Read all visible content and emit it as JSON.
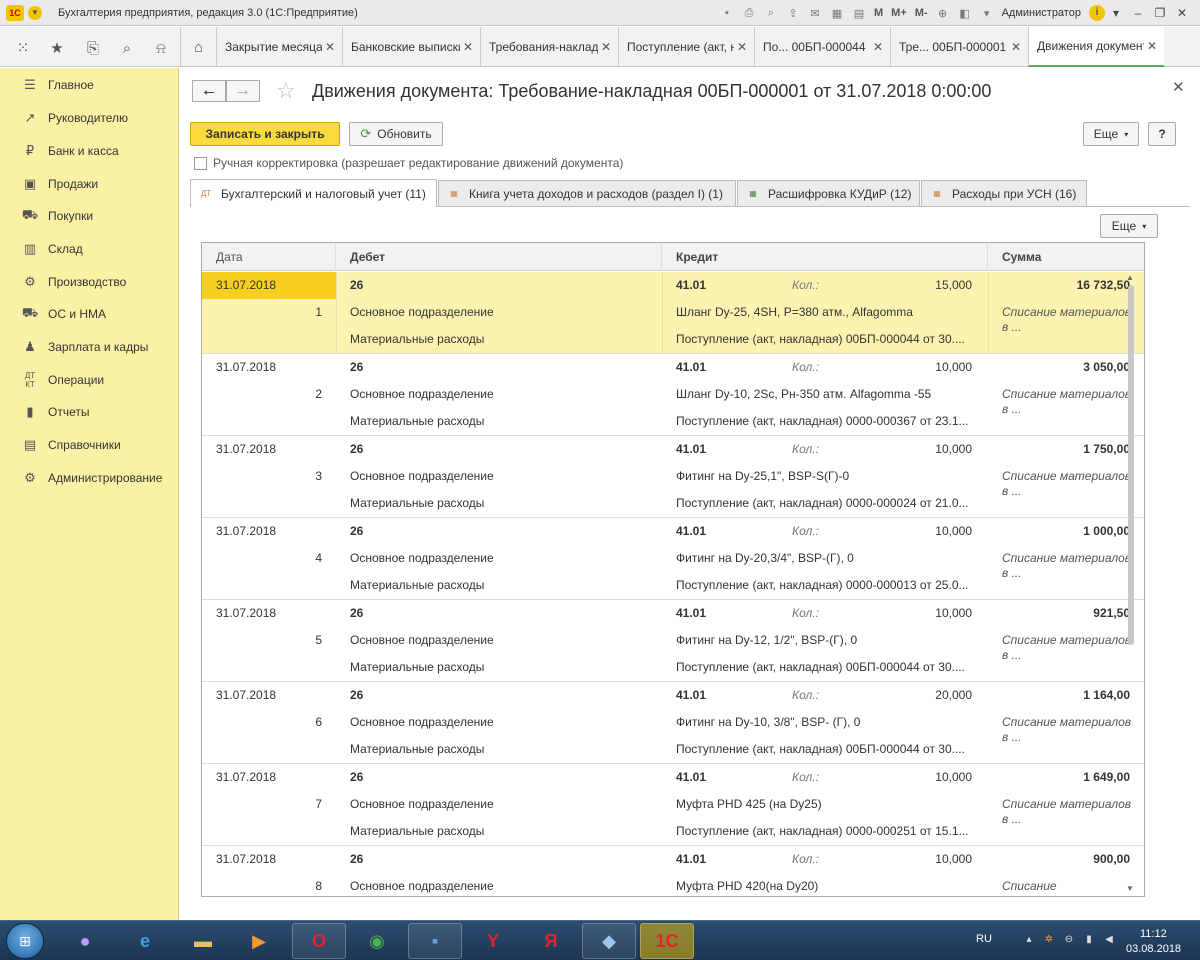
{
  "window": {
    "title": "Бухгалтерия предприятия, редакция 3.0  (1С:Предприятие)",
    "logo_text": "1С",
    "toolbar_m": "M",
    "toolbar_mplus": "M+",
    "toolbar_mminus": "M-",
    "user": "Администратор"
  },
  "tabs": [
    {
      "label": "Закрытие месяца"
    },
    {
      "label": "Банковские выписки"
    },
    {
      "label": "Требования-накладные"
    },
    {
      "label": "Поступление (акт, накладная)"
    },
    {
      "label": "По... 00БП-000044"
    },
    {
      "label": "Тре... 00БП-000001"
    },
    {
      "label": "Движения документа"
    }
  ],
  "sidebar": {
    "items": [
      {
        "label": "Главное",
        "icon": "menu-icon"
      },
      {
        "label": "Руководителю",
        "icon": "chart-trend-icon"
      },
      {
        "label": "Банк и касса",
        "icon": "ruble-icon"
      },
      {
        "label": "Продажи",
        "icon": "cash-register-icon"
      },
      {
        "label": "Покупки",
        "icon": "cart-icon"
      },
      {
        "label": "Склад",
        "icon": "warehouse-icon"
      },
      {
        "label": "Производство",
        "icon": "factory-icon"
      },
      {
        "label": "ОС и НМА",
        "icon": "truck-icon"
      },
      {
        "label": "Зарплата и кадры",
        "icon": "person-icon"
      },
      {
        "label": "Операции",
        "icon": "debit-credit-icon"
      },
      {
        "label": "Отчеты",
        "icon": "bar-chart-icon"
      },
      {
        "label": "Справочники",
        "icon": "book-icon"
      },
      {
        "label": "Администрирование",
        "icon": "gear-icon"
      }
    ]
  },
  "form": {
    "title": "Движения документа: Требование-накладная 00БП-000001 от 31.07.2018 0:00:00",
    "save_close": "Записать и закрыть",
    "refresh": "Обновить",
    "more": "Еще",
    "help": "?",
    "manual_correction": "Ручная корректировка (разрешает редактирование движений документа)",
    "form_tabs": [
      {
        "label": "Бухгалтерский и налоговый учет (11)"
      },
      {
        "label": "Книга учета доходов и расходов (раздел I) (1)"
      },
      {
        "label": "Расшифровка КУДиР (12)"
      },
      {
        "label": "Расходы при УСН (16)"
      }
    ],
    "table_more": "Еще"
  },
  "table": {
    "columns": {
      "date": "Дата",
      "debit": "Дебет",
      "credit": "Кредит",
      "sum": "Сумма"
    },
    "qty_label": "Кол.:",
    "rows": [
      {
        "date": "31.07.2018",
        "num": "1",
        "debit": "26",
        "debit2": "Основное подразделение",
        "debit3": "Материальные расходы",
        "credit": "41.01",
        "credit2": "Шланг Dy-25, 4SH, P=380  атм., Alfagomma",
        "credit3": "Поступление (акт, накладная) 00БП-000044 от 30....",
        "qty": "15,000",
        "sum": "16 732,50",
        "desc": "Списание материалов в ..."
      },
      {
        "date": "31.07.2018",
        "num": "2",
        "debit": "26",
        "debit2": "Основное подразделение",
        "debit3": "Материальные расходы",
        "credit": "41.01",
        "credit2": "Шланг Dy-10, 2Sc, Pн-350  атм. Alfagomma -55",
        "credit3": "Поступление (акт, накладная) 0000-000367 от 23.1...",
        "qty": "10,000",
        "sum": "3 050,00",
        "desc": "Списание материалов в ..."
      },
      {
        "date": "31.07.2018",
        "num": "3",
        "debit": "26",
        "debit2": "Основное подразделение",
        "debit3": "Материальные расходы",
        "credit": "41.01",
        "credit2": "Фитинг на Dy-25,1\", BSP-S(Г)-0",
        "credit3": "Поступление (акт, накладная) 0000-000024 от 21.0...",
        "qty": "10,000",
        "sum": "1 750,00",
        "desc": "Списание материалов в ..."
      },
      {
        "date": "31.07.2018",
        "num": "4",
        "debit": "26",
        "debit2": "Основное подразделение",
        "debit3": "Материальные расходы",
        "credit": "41.01",
        "credit2": "Фитинг на Dy-20,3/4\", BSP-(Г), 0",
        "credit3": "Поступление (акт, накладная) 0000-000013 от 25.0...",
        "qty": "10,000",
        "sum": "1 000,00",
        "desc": "Списание материалов в ..."
      },
      {
        "date": "31.07.2018",
        "num": "5",
        "debit": "26",
        "debit2": "Основное подразделение",
        "debit3": "Материальные расходы",
        "credit": "41.01",
        "credit2": "Фитинг на Dy-12, 1/2\", BSP-(Г), 0",
        "credit3": "Поступление (акт, накладная) 00БП-000044 от 30....",
        "qty": "10,000",
        "sum": "921,50",
        "desc": "Списание материалов в ..."
      },
      {
        "date": "31.07.2018",
        "num": "6",
        "debit": "26",
        "debit2": "Основное подразделение",
        "debit3": "Материальные расходы",
        "credit": "41.01",
        "credit2": "Фитинг на Dy-10, 3/8\", BSP- (Г), 0",
        "credit3": "Поступление (акт, накладная) 00БП-000044 от 30....",
        "qty": "20,000",
        "sum": "1 164,00",
        "desc": "Списание материалов в ..."
      },
      {
        "date": "31.07.2018",
        "num": "7",
        "debit": "26",
        "debit2": "Основное подразделение",
        "debit3": "Материальные расходы",
        "credit": "41.01",
        "credit2": "Муфта PHD 425 (на Dy25)",
        "credit3": "Поступление (акт, накладная) 0000-000251 от 15.1...",
        "qty": "10,000",
        "sum": "1 649,00",
        "desc": "Списание материалов в ..."
      },
      {
        "date": "31.07.2018",
        "num": "8",
        "debit": "26",
        "debit2": "Основное подразделение",
        "debit3": "",
        "credit": "41.01",
        "credit2": "Муфта PHD 420(на Dy20)",
        "credit3": "",
        "qty": "10,000",
        "sum": "900,00",
        "desc": "Списание"
      }
    ]
  },
  "taskbar": {
    "lang": "RU",
    "time": "11:12",
    "date": "03.08.2018"
  }
}
